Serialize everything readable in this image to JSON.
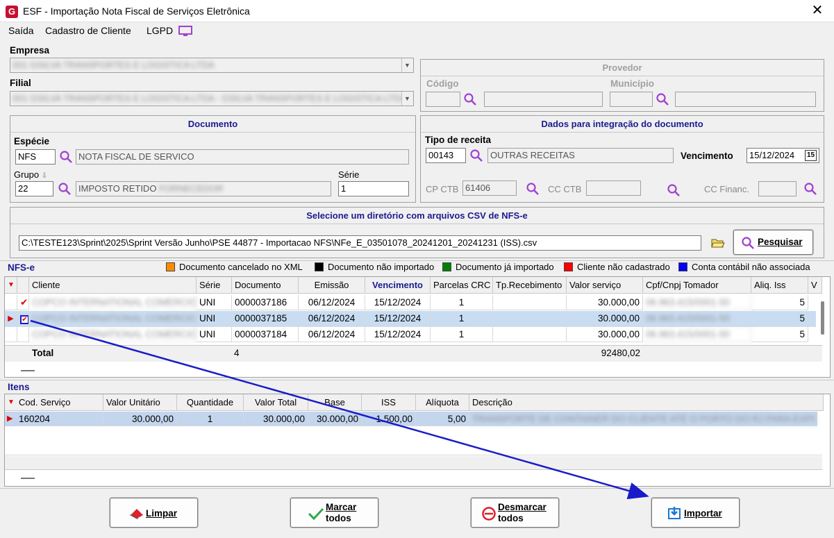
{
  "window": {
    "title": "ESF - Importação Nota Fiscal de Serviços Eletrônica",
    "app_icon": "G",
    "close": "✕"
  },
  "menu": {
    "items": [
      "Saída",
      "Cadastro de Cliente",
      "LGPD"
    ]
  },
  "empresa": {
    "label": "Empresa",
    "value": "001 GSILVA TRANSPORTES E LOGISTICA LTDA"
  },
  "filial": {
    "label": "Filial",
    "value": "001 GSILVA TRANSPORTES E LOGISTICA LTDA - GSILVA TRANSPORTES E LOGISTICA LTDA"
  },
  "provedor": {
    "title": "Provedor",
    "codigo_label": "Código",
    "municipio_label": "Município"
  },
  "documento": {
    "title": "Documento",
    "especie_label": "Espécie",
    "especie_code": "NFS",
    "especie_desc": "NOTA FISCAL DE SERVICO",
    "grupo_label": "Grupo",
    "grupo_code": "22",
    "grupo_desc": "IMPOSTO RETIDO",
    "grupo_desc_hidden": "FORNECEDOR",
    "serie_label": "Série",
    "serie_value": "1"
  },
  "integracao": {
    "title": "Dados para integração do documento",
    "tipo_receita_label": "Tipo de receita",
    "tipo_receita_code": "00143",
    "tipo_receita_desc": "OUTRAS RECEITAS",
    "vencimento_label": "Vencimento",
    "vencimento_value": "15/12/2024",
    "calendar_glyph": "15",
    "cp_ctb_label": "CP CTB",
    "cp_ctb_value": "61406",
    "cc_ctb_label": "CC CTB",
    "cc_financ_label": "CC Financ."
  },
  "diretorio": {
    "title": "Selecione um diretório com arquivos CSV de NFS-e",
    "path": "C:\\TESTE123\\Sprint\\2025\\Sprint Versão Junho\\PSE 44877 - Importacao NFS\\NFe_E_03501078_20241201_20241231 (ISS).csv",
    "pesquisar_label": "Pesquisar"
  },
  "nfse": {
    "section_label": "NFS-e",
    "legend": [
      {
        "color": "#ff8c00",
        "label": "Documento cancelado no XML"
      },
      {
        "color": "#000000",
        "label": "Documento não importado"
      },
      {
        "color": "#008000",
        "label": "Documento já importado"
      },
      {
        "color": "#ff0000",
        "label": "Cliente não cadastrado"
      },
      {
        "color": "#0000ff",
        "label": "Conta contábil não associada"
      }
    ],
    "columns": [
      "Cliente",
      "Série",
      "Documento",
      "Emissão",
      "Vencimento",
      "Parcelas CRC",
      "Tp.Recebimento",
      "Valor serviço",
      "Cpf/Cnpj Tomador",
      "Aliq. Iss",
      "V"
    ],
    "rows": [
      {
        "cliente": "COPCO INTERNATIONAL COMERCIO",
        "serie": "UNI",
        "documento": "0000037186",
        "emissao": "06/12/2024",
        "vencimento": "15/12/2024",
        "parcelas": "1",
        "tp": "",
        "valor": "30.000,00",
        "cnpj": "06.963.415/0001-50",
        "aliq": "5"
      },
      {
        "cliente": "COPCO INTERNATIONAL COMERCIO",
        "serie": "UNI",
        "documento": "0000037185",
        "emissao": "06/12/2024",
        "vencimento": "15/12/2024",
        "parcelas": "1",
        "tp": "",
        "valor": "30.000,00",
        "cnpj": "06.963.415/0001-50",
        "aliq": "5"
      },
      {
        "cliente": "COPCO INTERNATIONAL COMERCIO",
        "serie": "UNI",
        "documento": "0000037184",
        "emissao": "06/12/2024",
        "vencimento": "15/12/2024",
        "parcelas": "1",
        "tp": "",
        "valor": "30.000,00",
        "cnpj": "06.963.415/0001-50",
        "aliq": "5"
      }
    ],
    "total_label": "Total",
    "total_count": "4",
    "total_valor": "92480,02"
  },
  "itens": {
    "section_label": "Itens",
    "columns": [
      "Cod. Serviço",
      "Valor Unitário",
      "Quantidade",
      "Valor Total",
      "Base",
      "ISS",
      "Alíquota",
      "Descrição"
    ],
    "rows": [
      {
        "cod": "160204",
        "unit": "30.000,00",
        "qtd": "1",
        "total": "30.000,00",
        "base": "30.000,00",
        "iss": "1.500,00",
        "aliq": "5,00",
        "desc": "TRANSPORTE DE CONTAINER DO CLIENTE ATE O PORTO DO RJ PARA EXPO"
      }
    ]
  },
  "buttons": {
    "limpar": "Limpar",
    "marcar_1": "Marcar",
    "marcar_2": "todos",
    "desmarcar_1": "Desmarcar",
    "desmarcar_2": "todos",
    "importar": "Importar"
  },
  "colors": {
    "accent": "#1b1b8f",
    "arrow": "#1a1ac8",
    "selected_row": "#c9ddf2",
    "magnifier": "#a040d0"
  }
}
